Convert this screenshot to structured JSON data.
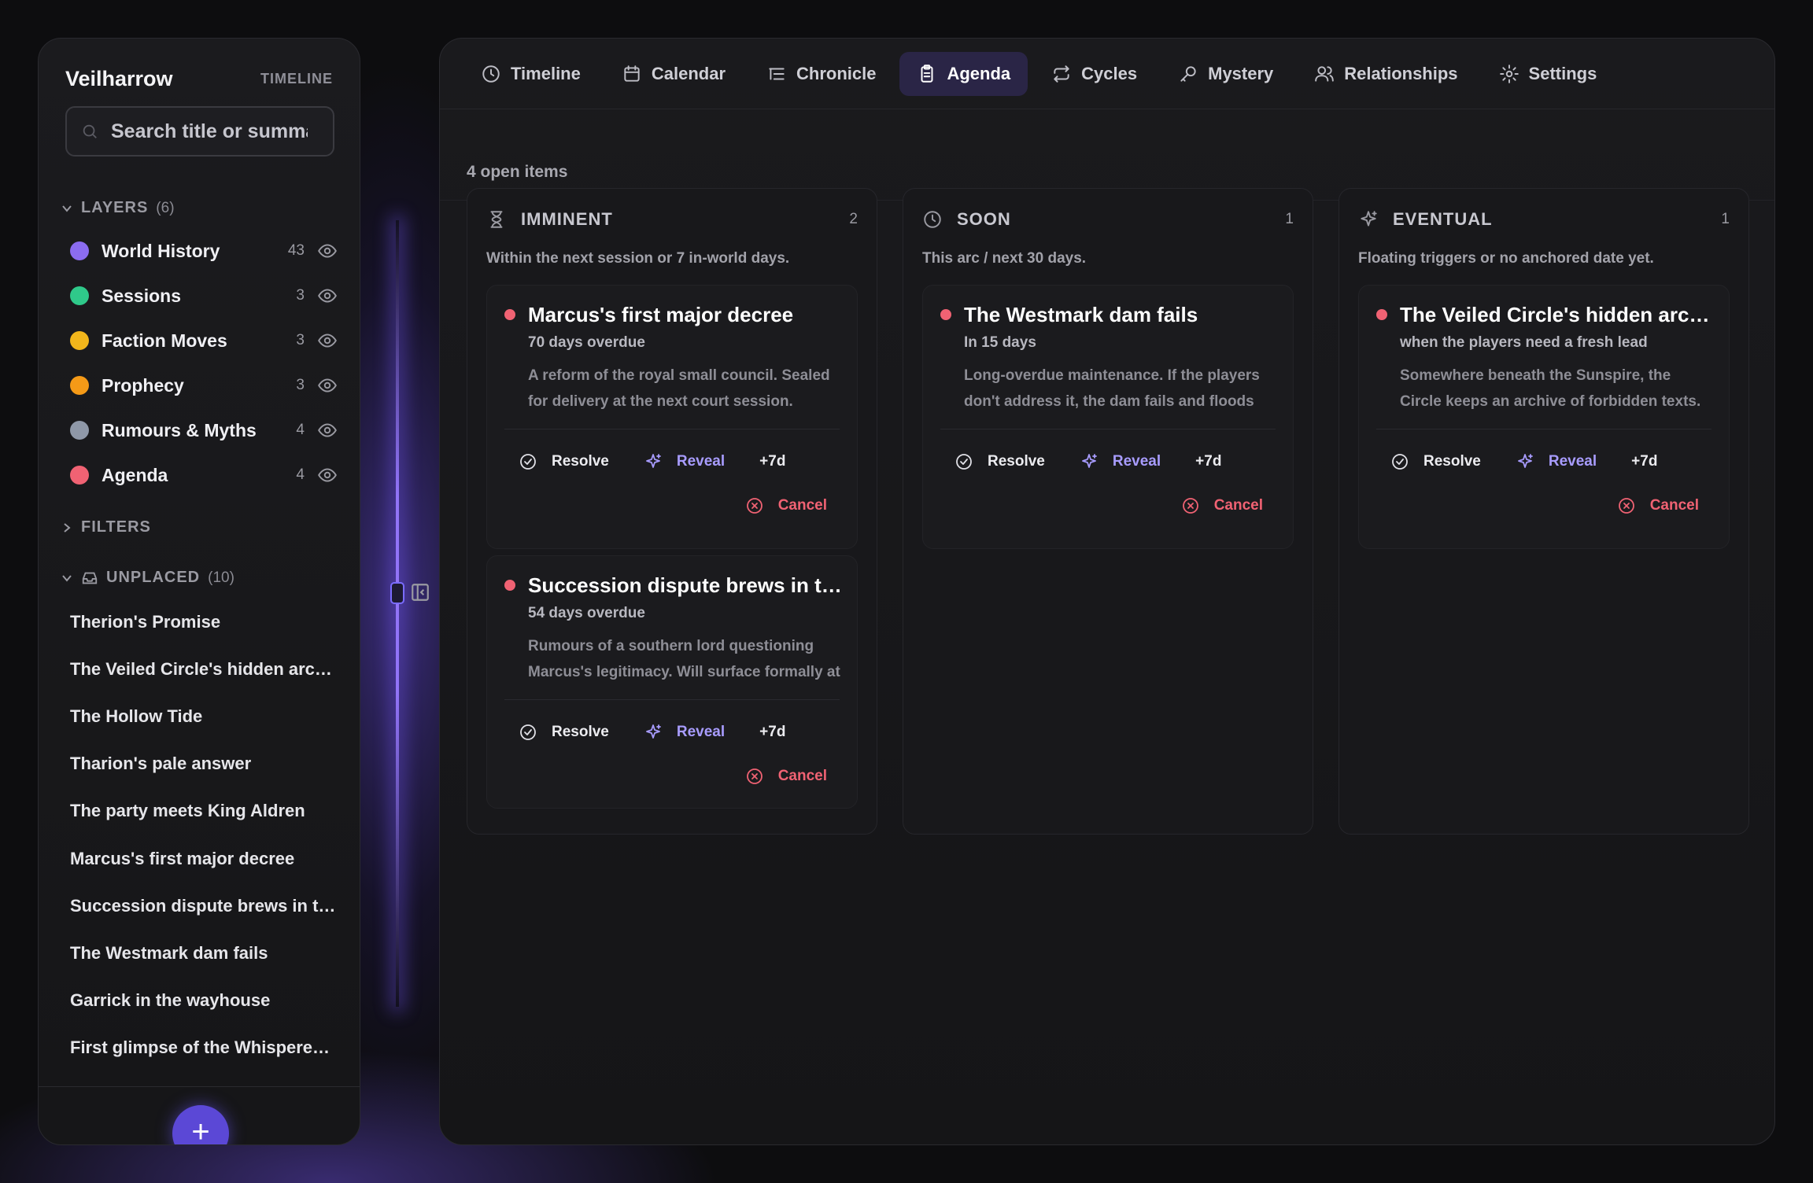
{
  "sidebar": {
    "brand": "Veilharrow",
    "brand_tag": "TIMELINE",
    "search_placeholder": "Search title or summary",
    "layers_label": "LAYERS",
    "layers_count": "(6)",
    "layers": [
      {
        "name": "World History",
        "count": "43",
        "color": "#8b6cf0"
      },
      {
        "name": "Sessions",
        "count": "3",
        "color": "#2fc98a"
      },
      {
        "name": "Faction Moves",
        "count": "3",
        "color": "#f2b61b"
      },
      {
        "name": "Prophecy",
        "count": "3",
        "color": "#f59a17"
      },
      {
        "name": "Rumours & Myths",
        "count": "4",
        "color": "#8f98a8"
      },
      {
        "name": "Agenda",
        "count": "4",
        "color": "#f06273"
      }
    ],
    "filters_label": "FILTERS",
    "unplaced_label": "UNPLACED",
    "unplaced_count": "(10)",
    "unplaced": [
      "Therion's Promise",
      "The Veiled Circle's hidden archive",
      "The Hollow Tide",
      "Tharion's pale answer",
      "The party meets King Aldren",
      "Marcus's first major decree",
      "Succession dispute brews in the south",
      "The Westmark dam fails",
      "Garrick in the wayhouse",
      "First glimpse of the Whispered Order"
    ],
    "add_label": "+"
  },
  "tabs": [
    "Timeline",
    "Calendar",
    "Chronicle",
    "Agenda",
    "Cycles",
    "Mystery",
    "Relationships",
    "Settings"
  ],
  "active_tab": "Agenda",
  "open_items": "4 open items",
  "columns": [
    {
      "title": "IMMINENT",
      "count": "2",
      "icon": "hourglass-icon",
      "desc": "Within the next session or 7 in-world days.",
      "cards": [
        {
          "title": "Marcus's first major decree",
          "when": "70 days overdue",
          "body": "A reform of the royal small council. Sealed for delivery at the next court session."
        },
        {
          "title": "Succession dispute brews in the south",
          "when": "54 days overdue",
          "body": "Rumours of a southern lord questioning Marcus's legitimacy. Will surface formally at court."
        }
      ]
    },
    {
      "title": "SOON",
      "count": "1",
      "icon": "clock-icon",
      "desc": "This arc / next 30 days.",
      "cards": [
        {
          "title": "The Westmark dam fails",
          "when": "In 15 days",
          "body": "Long-overdue maintenance. If the players don't address it, the dam fails and floods the valley."
        }
      ]
    },
    {
      "title": "EVENTUAL",
      "count": "1",
      "icon": "sparkle-icon",
      "desc": "Floating triggers or no anchored date yet.",
      "cards": [
        {
          "title": "The Veiled Circle's hidden archive",
          "when": "when the players need a fresh lead",
          "body": "Somewhere beneath the Sunspire, the Circle keeps an archive of forbidden texts."
        }
      ]
    }
  ],
  "actions": {
    "resolve": "Resolve",
    "reveal": "Reveal",
    "delay": "+7d",
    "cancel": "Cancel"
  },
  "colors": {
    "accent": "#5b48d6",
    "active_tab_bg": "#2a2546",
    "reveal": "#a89cff",
    "cancel": "#f06273"
  }
}
